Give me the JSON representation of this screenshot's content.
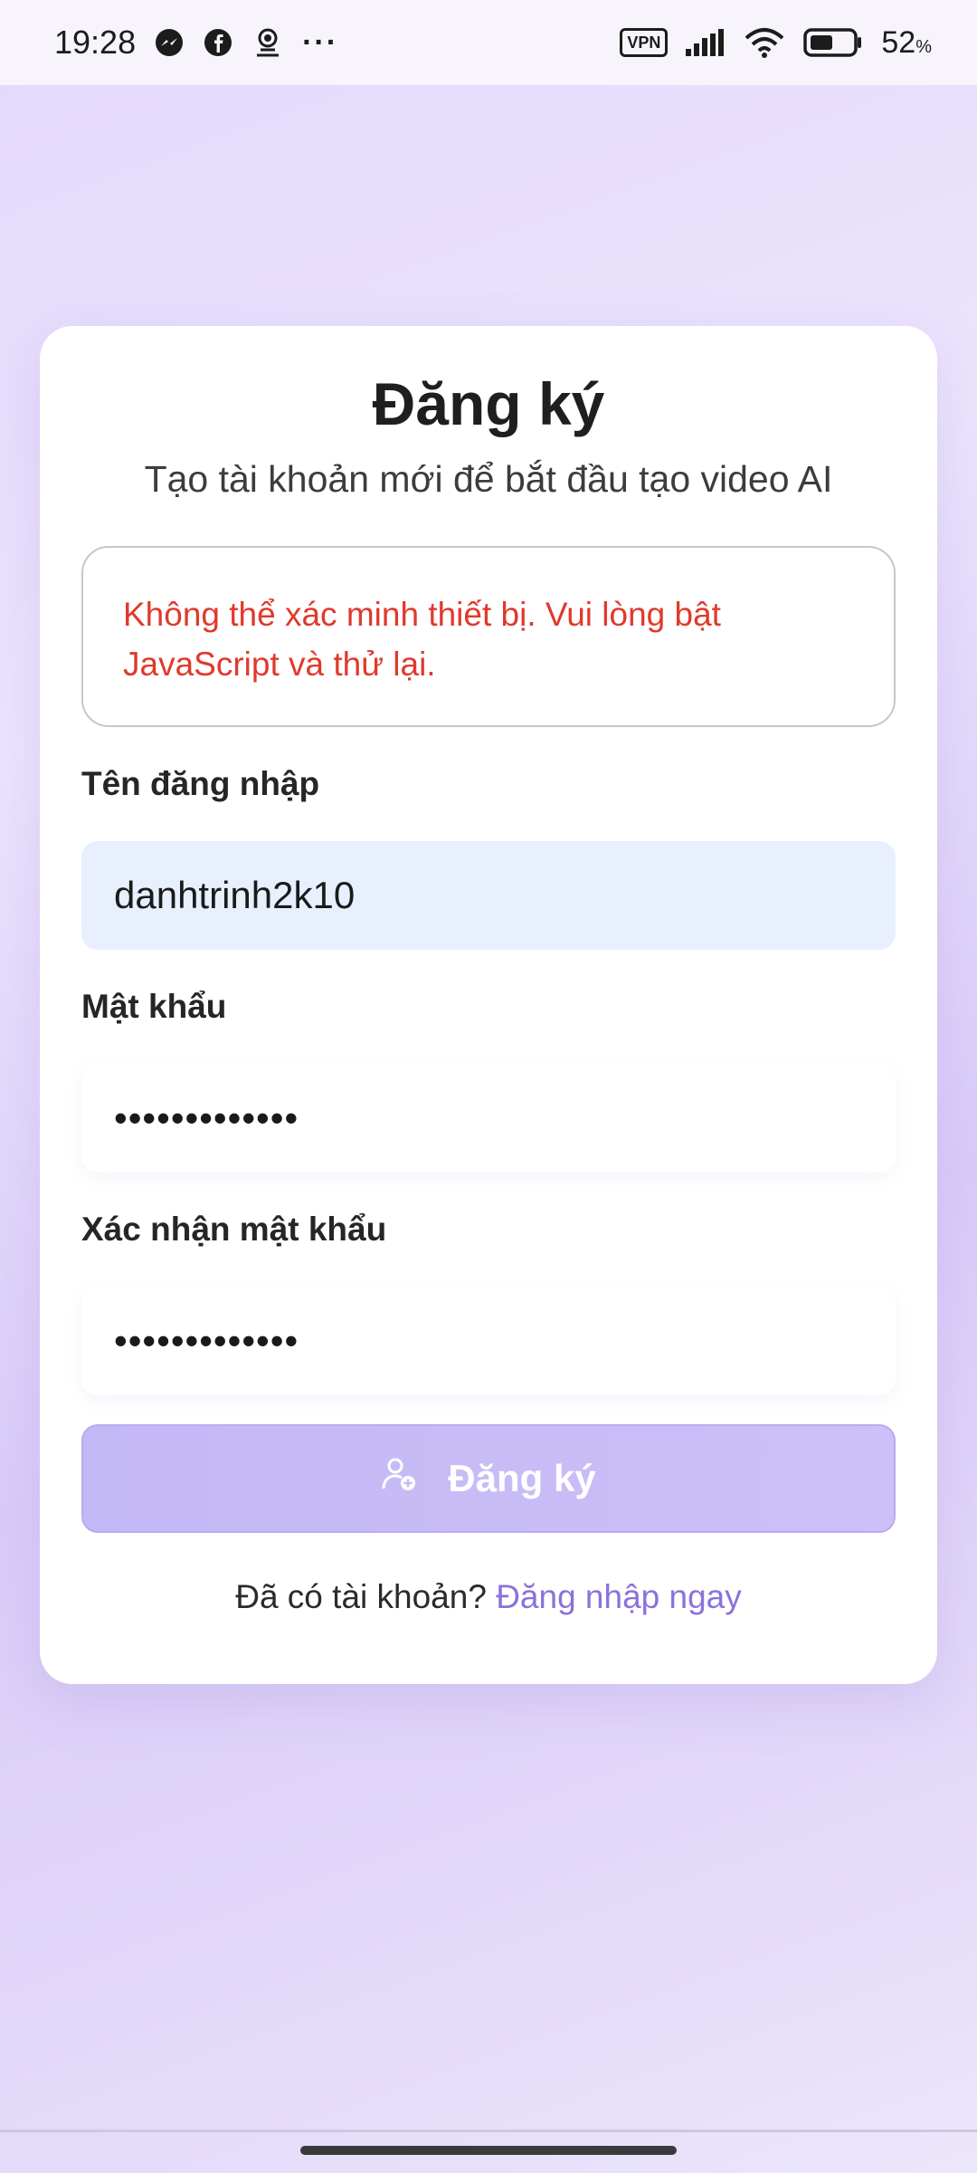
{
  "status_bar": {
    "time": "19:28",
    "notification_icons": [
      "messenger-icon",
      "facebook-icon",
      "spy-icon",
      "more-icon"
    ],
    "more": "···",
    "vpn": "VPN",
    "battery_percent": "52",
    "battery_unit": "%"
  },
  "card": {
    "title": "Đăng ký",
    "subtitle": "Tạo tài khoản mới để bắt đầu tạo video AI",
    "error_message": "Không thể xác minh thiết bị. Vui lòng bật JavaScript và thử lại."
  },
  "form": {
    "username": {
      "label": "Tên đăng nhập",
      "value": "danhtrinh2k10"
    },
    "password": {
      "label": "Mật khẩu",
      "value": "•••••••••••••"
    },
    "confirm_password": {
      "label": "Xác nhận mật khẩu",
      "value": "•••••••••••••"
    },
    "submit_label": "Đăng ký"
  },
  "footer": {
    "question": "Đã có tài khoản?",
    "link": "Đăng nhập ngay"
  },
  "colors": {
    "error": "#e0392c",
    "accent": "#8a72dc",
    "button": "#c6baf6",
    "filled_input": "#e8effd"
  }
}
